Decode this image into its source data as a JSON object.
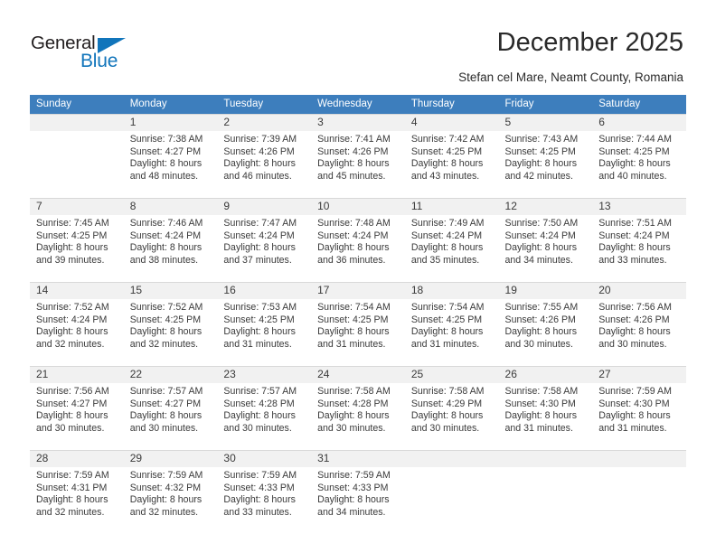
{
  "brand": {
    "name_part1": "General",
    "name_part2": "Blue",
    "accent_color": "#1175bb"
  },
  "header": {
    "title": "December 2025",
    "subtitle": "Stefan cel Mare, Neamt County, Romania"
  },
  "theme": {
    "header_row_bg": "#3d7ebd",
    "daynum_bg": "#f1f1f1",
    "text_color": "#3a3a3a"
  },
  "weekday_headers": [
    "Sunday",
    "Monday",
    "Tuesday",
    "Wednesday",
    "Thursday",
    "Friday",
    "Saturday"
  ],
  "weeks": [
    [
      {
        "day": "",
        "sunrise": "",
        "sunset": "",
        "daylight1": "",
        "daylight2": ""
      },
      {
        "day": "1",
        "sunrise": "Sunrise: 7:38 AM",
        "sunset": "Sunset: 4:27 PM",
        "daylight1": "Daylight: 8 hours",
        "daylight2": "and 48 minutes."
      },
      {
        "day": "2",
        "sunrise": "Sunrise: 7:39 AM",
        "sunset": "Sunset: 4:26 PM",
        "daylight1": "Daylight: 8 hours",
        "daylight2": "and 46 minutes."
      },
      {
        "day": "3",
        "sunrise": "Sunrise: 7:41 AM",
        "sunset": "Sunset: 4:26 PM",
        "daylight1": "Daylight: 8 hours",
        "daylight2": "and 45 minutes."
      },
      {
        "day": "4",
        "sunrise": "Sunrise: 7:42 AM",
        "sunset": "Sunset: 4:25 PM",
        "daylight1": "Daylight: 8 hours",
        "daylight2": "and 43 minutes."
      },
      {
        "day": "5",
        "sunrise": "Sunrise: 7:43 AM",
        "sunset": "Sunset: 4:25 PM",
        "daylight1": "Daylight: 8 hours",
        "daylight2": "and 42 minutes."
      },
      {
        "day": "6",
        "sunrise": "Sunrise: 7:44 AM",
        "sunset": "Sunset: 4:25 PM",
        "daylight1": "Daylight: 8 hours",
        "daylight2": "and 40 minutes."
      }
    ],
    [
      {
        "day": "7",
        "sunrise": "Sunrise: 7:45 AM",
        "sunset": "Sunset: 4:25 PM",
        "daylight1": "Daylight: 8 hours",
        "daylight2": "and 39 minutes."
      },
      {
        "day": "8",
        "sunrise": "Sunrise: 7:46 AM",
        "sunset": "Sunset: 4:24 PM",
        "daylight1": "Daylight: 8 hours",
        "daylight2": "and 38 minutes."
      },
      {
        "day": "9",
        "sunrise": "Sunrise: 7:47 AM",
        "sunset": "Sunset: 4:24 PM",
        "daylight1": "Daylight: 8 hours",
        "daylight2": "and 37 minutes."
      },
      {
        "day": "10",
        "sunrise": "Sunrise: 7:48 AM",
        "sunset": "Sunset: 4:24 PM",
        "daylight1": "Daylight: 8 hours",
        "daylight2": "and 36 minutes."
      },
      {
        "day": "11",
        "sunrise": "Sunrise: 7:49 AM",
        "sunset": "Sunset: 4:24 PM",
        "daylight1": "Daylight: 8 hours",
        "daylight2": "and 35 minutes."
      },
      {
        "day": "12",
        "sunrise": "Sunrise: 7:50 AM",
        "sunset": "Sunset: 4:24 PM",
        "daylight1": "Daylight: 8 hours",
        "daylight2": "and 34 minutes."
      },
      {
        "day": "13",
        "sunrise": "Sunrise: 7:51 AM",
        "sunset": "Sunset: 4:24 PM",
        "daylight1": "Daylight: 8 hours",
        "daylight2": "and 33 minutes."
      }
    ],
    [
      {
        "day": "14",
        "sunrise": "Sunrise: 7:52 AM",
        "sunset": "Sunset: 4:24 PM",
        "daylight1": "Daylight: 8 hours",
        "daylight2": "and 32 minutes."
      },
      {
        "day": "15",
        "sunrise": "Sunrise: 7:52 AM",
        "sunset": "Sunset: 4:25 PM",
        "daylight1": "Daylight: 8 hours",
        "daylight2": "and 32 minutes."
      },
      {
        "day": "16",
        "sunrise": "Sunrise: 7:53 AM",
        "sunset": "Sunset: 4:25 PM",
        "daylight1": "Daylight: 8 hours",
        "daylight2": "and 31 minutes."
      },
      {
        "day": "17",
        "sunrise": "Sunrise: 7:54 AM",
        "sunset": "Sunset: 4:25 PM",
        "daylight1": "Daylight: 8 hours",
        "daylight2": "and 31 minutes."
      },
      {
        "day": "18",
        "sunrise": "Sunrise: 7:54 AM",
        "sunset": "Sunset: 4:25 PM",
        "daylight1": "Daylight: 8 hours",
        "daylight2": "and 31 minutes."
      },
      {
        "day": "19",
        "sunrise": "Sunrise: 7:55 AM",
        "sunset": "Sunset: 4:26 PM",
        "daylight1": "Daylight: 8 hours",
        "daylight2": "and 30 minutes."
      },
      {
        "day": "20",
        "sunrise": "Sunrise: 7:56 AM",
        "sunset": "Sunset: 4:26 PM",
        "daylight1": "Daylight: 8 hours",
        "daylight2": "and 30 minutes."
      }
    ],
    [
      {
        "day": "21",
        "sunrise": "Sunrise: 7:56 AM",
        "sunset": "Sunset: 4:27 PM",
        "daylight1": "Daylight: 8 hours",
        "daylight2": "and 30 minutes."
      },
      {
        "day": "22",
        "sunrise": "Sunrise: 7:57 AM",
        "sunset": "Sunset: 4:27 PM",
        "daylight1": "Daylight: 8 hours",
        "daylight2": "and 30 minutes."
      },
      {
        "day": "23",
        "sunrise": "Sunrise: 7:57 AM",
        "sunset": "Sunset: 4:28 PM",
        "daylight1": "Daylight: 8 hours",
        "daylight2": "and 30 minutes."
      },
      {
        "day": "24",
        "sunrise": "Sunrise: 7:58 AM",
        "sunset": "Sunset: 4:28 PM",
        "daylight1": "Daylight: 8 hours",
        "daylight2": "and 30 minutes."
      },
      {
        "day": "25",
        "sunrise": "Sunrise: 7:58 AM",
        "sunset": "Sunset: 4:29 PM",
        "daylight1": "Daylight: 8 hours",
        "daylight2": "and 30 minutes."
      },
      {
        "day": "26",
        "sunrise": "Sunrise: 7:58 AM",
        "sunset": "Sunset: 4:30 PM",
        "daylight1": "Daylight: 8 hours",
        "daylight2": "and 31 minutes."
      },
      {
        "day": "27",
        "sunrise": "Sunrise: 7:59 AM",
        "sunset": "Sunset: 4:30 PM",
        "daylight1": "Daylight: 8 hours",
        "daylight2": "and 31 minutes."
      }
    ],
    [
      {
        "day": "28",
        "sunrise": "Sunrise: 7:59 AM",
        "sunset": "Sunset: 4:31 PM",
        "daylight1": "Daylight: 8 hours",
        "daylight2": "and 32 minutes."
      },
      {
        "day": "29",
        "sunrise": "Sunrise: 7:59 AM",
        "sunset": "Sunset: 4:32 PM",
        "daylight1": "Daylight: 8 hours",
        "daylight2": "and 32 minutes."
      },
      {
        "day": "30",
        "sunrise": "Sunrise: 7:59 AM",
        "sunset": "Sunset: 4:33 PM",
        "daylight1": "Daylight: 8 hours",
        "daylight2": "and 33 minutes."
      },
      {
        "day": "31",
        "sunrise": "Sunrise: 7:59 AM",
        "sunset": "Sunset: 4:33 PM",
        "daylight1": "Daylight: 8 hours",
        "daylight2": "and 34 minutes."
      },
      {
        "day": "",
        "sunrise": "",
        "sunset": "",
        "daylight1": "",
        "daylight2": ""
      },
      {
        "day": "",
        "sunrise": "",
        "sunset": "",
        "daylight1": "",
        "daylight2": ""
      },
      {
        "day": "",
        "sunrise": "",
        "sunset": "",
        "daylight1": "",
        "daylight2": ""
      }
    ]
  ]
}
